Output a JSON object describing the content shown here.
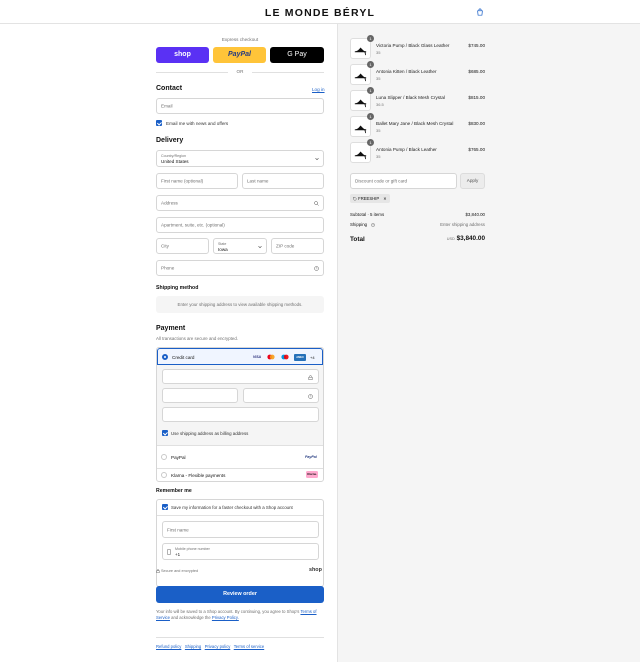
{
  "header": {
    "brand": "LE MONDE BÉRYL",
    "cart_icon": "shopping-bag-icon"
  },
  "express": {
    "title": "Express checkout",
    "shop_label": "shop",
    "paypal_label": "PayPal",
    "gpay_label": "G Pay",
    "or_label": "OR"
  },
  "contact": {
    "heading": "Contact",
    "login_label": "Log in",
    "email_placeholder": "Email",
    "news_label": "Email me with news and offers"
  },
  "delivery": {
    "heading": "Delivery",
    "country_label": "Country/Region",
    "country_value": "United States",
    "first_name_placeholder": "First name (optional)",
    "last_name_placeholder": "Last name",
    "address_placeholder": "Address",
    "apartment_placeholder": "Apartment, suite, etc. (optional)",
    "city_placeholder": "City",
    "state_label": "State",
    "state_value": "Iowa",
    "zip_placeholder": "ZIP code",
    "phone_placeholder": "Phone"
  },
  "shipping_method": {
    "heading": "Shipping method",
    "notice": "Enter your shipping address to view available shipping methods."
  },
  "payment": {
    "heading": "Payment",
    "subtitle": "All transactions are secure and encrypted.",
    "credit_card_label": "Credit card",
    "card_brands": [
      "VISA",
      "MC",
      "MC",
      "AMEX"
    ],
    "more_cards": "+4",
    "billing_label": "Use shipping address as billing address",
    "paypal_label": "PayPal",
    "paypal_logo": "PayPal",
    "klarna_label": "Klarna - Flexible payments",
    "klarna_logo": "Klarna."
  },
  "remember": {
    "heading": "Remember me",
    "save_label": "Save my information for a faster checkout with a Shop account",
    "first_name_placeholder": "First name",
    "phone_label": "Mobile phone number",
    "phone_prefix": "+1",
    "secure_label": "Secure and encrypted",
    "shop_label": "shop"
  },
  "review": {
    "button_label": "Review order",
    "disclaimer_1": "Your info will be saved to a Shop account. By continuing, you agree to Shop's",
    "terms_label": "Terms of Service",
    "disclaimer_2": "and acknowledge the",
    "privacy_label": "Privacy Policy."
  },
  "footer": {
    "links": [
      "Refund policy",
      "Shipping",
      "Privacy policy",
      "Terms of service"
    ]
  },
  "cart": {
    "items": [
      {
        "qty": "1",
        "name": "Victoria Pump / Black Glass Leather",
        "variant": "35",
        "price": "$745.00"
      },
      {
        "qty": "1",
        "name": "Antonia Kitten / Black Leather",
        "variant": "35",
        "price": "$685.00"
      },
      {
        "qty": "1",
        "name": "Luna Slipper / Black Mesh Crystal",
        "variant": "36.5",
        "price": "$815.00"
      },
      {
        "qty": "1",
        "name": "Ballet Mary Jane / Black Mesh Crystal",
        "variant": "35",
        "price": "$830.00"
      },
      {
        "qty": "1",
        "name": "Antonia Pump / Black Leather",
        "variant": "35",
        "price": "$765.00"
      }
    ],
    "discount_placeholder": "Discount code or gift card",
    "apply_label": "Apply",
    "coupon": "FREESHIP",
    "subtotal_label": "Subtotal · 5 items",
    "subtotal_value": "$3,840.00",
    "shipping_label": "Shipping",
    "shipping_value": "Enter shipping address",
    "total_label": "Total",
    "currency": "USD",
    "total_value": "$3,840.00"
  }
}
